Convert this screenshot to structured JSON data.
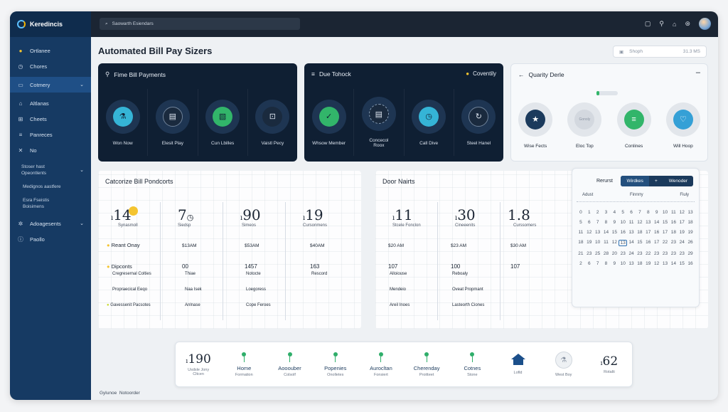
{
  "app": {
    "name": "Keredincis"
  },
  "search": {
    "placeholder": "Saowarth Esiendars"
  },
  "sidebar": {
    "items": [
      {
        "label": "Ortlanee",
        "icon": "coin-icon"
      },
      {
        "label": "Chores",
        "icon": "clock-icon"
      },
      {
        "label": "Cotmery",
        "icon": "folder-icon"
      },
      {
        "label": "Altlanas",
        "icon": "bell-icon"
      },
      {
        "label": "Cheets",
        "icon": "grid-icon"
      },
      {
        "label": "Panreces",
        "icon": "list-icon"
      },
      {
        "label": "No",
        "icon": "x-icon"
      }
    ],
    "sub1a": "Stoser hast",
    "sub1b": "Opeontlents",
    "sub2": "Medignos aastfere",
    "sub3a": "Esra Fseistis",
    "sub3b": "Boisimens",
    "items2": [
      {
        "label": "Adoagesents"
      },
      {
        "label": "Paollo"
      }
    ]
  },
  "header": {
    "title": "Automated Bill Pay Sizers",
    "shop_label": "Shoph",
    "shop_amount": "31.3 MS"
  },
  "card1": {
    "title": "Fime Bill Payments",
    "tiles": [
      "Won Now",
      "Elesit Play",
      "Cun Lbilles",
      "Vaistl Pecy"
    ]
  },
  "card2": {
    "title": "Due Tohock",
    "badge": "Coventily",
    "tiles": [
      "Whsow Member",
      "Concecol Roox",
      "Call Dive",
      "Steel Hanel"
    ]
  },
  "card3": {
    "title": "Quarity Derle",
    "tiles": [
      "Wise Fects",
      "Eloc Top",
      "Conlines",
      "Will Hoop"
    ],
    "inner2": "Gonoly"
  },
  "panel1": {
    "title": "Catcorize Bill Pondcorts",
    "cols": [
      {
        "big": "14",
        "sub": "Synasmoll",
        "r1": "$13AM",
        "r2": "00",
        "r3": "Thiae",
        "r4": "Anlnase"
      },
      {
        "big": "7",
        "sub": "Siedsp",
        "r1": "$53AM",
        "r2": "1457",
        "r3": "Notocte",
        "r4": "Loegoress"
      },
      {
        "big": "90",
        "sub": "Simeos",
        "r1": "$40AM",
        "r2": "163",
        "r3": "Rescord",
        "r4": "Cope Feroes"
      },
      {
        "big": "19",
        "sub": "Cursonmens",
        "r1": "",
        "r2": "",
        "r3": "",
        "r4": ""
      }
    ],
    "rows": [
      "Reant Onay",
      "Dipconts",
      "Cregresernal Colties",
      "Propraecical Eeqo",
      "Gavessenit Pacsotes"
    ],
    "col2_extra": "Naa Isek"
  },
  "panel2": {
    "title": "Door Nairts",
    "cols": [
      {
        "big": "11",
        "sub": "Stcele Fonclon",
        "r1": "$20 AM",
        "r2": "107",
        "r3": "Alloiouse",
        "r4": "Mendeio"
      },
      {
        "big": "30",
        "sub": "Cineeenits",
        "r1": "$23 AM",
        "r2": "100",
        "r3": "Reboaly",
        "r4": "Oveat Propmant"
      },
      {
        "big": "1.8",
        "sub": "Curssomers",
        "r1": "$30 AM",
        "r2": "107",
        "r3": "",
        "r4": ""
      }
    ],
    "extra": [
      "Areil Inoes",
      "Lasteorth Ciones"
    ]
  },
  "calendar": {
    "label": "Rerurst",
    "tab1": "Wirdkes",
    "tab2": "Wenoder",
    "months": [
      "Adust",
      "Finnrry",
      "Fiuly"
    ],
    "days": [
      "0",
      "1",
      "2",
      "3",
      "4",
      "5",
      "6",
      "7",
      "8",
      "9",
      "10",
      "11",
      "12",
      "13",
      "5",
      "6",
      "7",
      "8",
      "9",
      "10",
      "11",
      "12",
      "13",
      "14",
      "15",
      "16",
      "17",
      "18",
      "11",
      "12",
      "13",
      "14",
      "15",
      "16",
      "13",
      "18",
      "17",
      "16",
      "17",
      "18",
      "19",
      "19",
      "18",
      "19",
      "10",
      "11",
      "12",
      "13",
      "14",
      "15",
      "16",
      "17",
      "22",
      "23",
      "24",
      "26",
      "21",
      "23",
      "25",
      "28",
      "20",
      "23",
      "24",
      "23",
      "22",
      "23",
      "23",
      "23",
      "23",
      "29",
      "2",
      "6",
      "7",
      "8",
      "9",
      "10",
      "13",
      "18",
      "19",
      "12",
      "13",
      "14",
      "15",
      "16"
    ],
    "selected_index": 47
  },
  "bottombar": {
    "items": [
      {
        "big": "190",
        "sub": "Usdsle Jony Cltcen"
      },
      {
        "label": "Home",
        "sub": "Formation"
      },
      {
        "label": "Aooouber",
        "sub": "Colsolf"
      },
      {
        "label": "Popenies",
        "sub": "Onolletes"
      },
      {
        "label": "Aurocltan",
        "sub": "Fonsiert"
      },
      {
        "label": "Cherenday",
        "sub": "Proitteet"
      },
      {
        "label": "Cotnes",
        "sub": "Stone"
      },
      {
        "label": "",
        "sub": "Lofld",
        "icon": "home-icon"
      },
      {
        "label": "",
        "sub": "West Boy",
        "icon": "flask-icon"
      },
      {
        "big": "62",
        "sub": "Rotalti"
      }
    ]
  },
  "footer": {
    "left": "Gylunoe",
    "right": "Notoorder"
  },
  "colors": {
    "sidebar": "#163a63",
    "dark_card": "#0f1f33",
    "accent_green": "#2fae6a",
    "accent_blue": "#2c6fb0"
  }
}
